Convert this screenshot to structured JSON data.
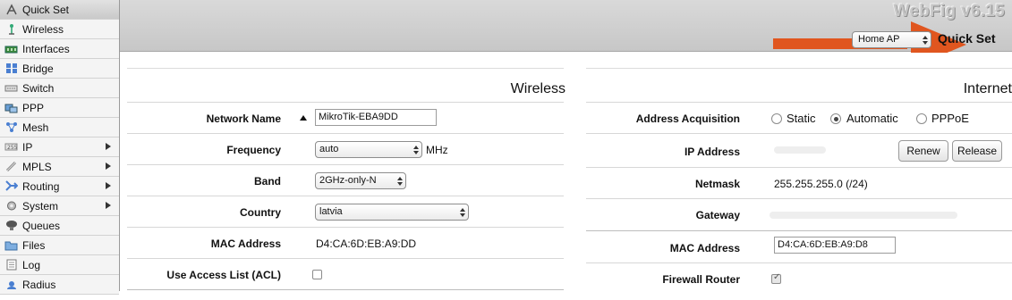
{
  "sidebar": {
    "items": [
      {
        "label": "Quick Set",
        "icon": "quickset-icon",
        "active": true,
        "arrow": false
      },
      {
        "label": "Wireless",
        "icon": "wireless-icon",
        "active": false,
        "arrow": false
      },
      {
        "label": "Interfaces",
        "icon": "interfaces-icon",
        "active": false,
        "arrow": false
      },
      {
        "label": "Bridge",
        "icon": "bridge-icon",
        "active": false,
        "arrow": false
      },
      {
        "label": "Switch",
        "icon": "switch-icon",
        "active": false,
        "arrow": false
      },
      {
        "label": "PPP",
        "icon": "ppp-icon",
        "active": false,
        "arrow": false
      },
      {
        "label": "Mesh",
        "icon": "mesh-icon",
        "active": false,
        "arrow": false
      },
      {
        "label": "IP",
        "icon": "ip-icon",
        "active": false,
        "arrow": true
      },
      {
        "label": "MPLS",
        "icon": "mpls-icon",
        "active": false,
        "arrow": true
      },
      {
        "label": "Routing",
        "icon": "routing-icon",
        "active": false,
        "arrow": true
      },
      {
        "label": "System",
        "icon": "system-icon",
        "active": false,
        "arrow": true
      },
      {
        "label": "Queues",
        "icon": "queues-icon",
        "active": false,
        "arrow": false
      },
      {
        "label": "Files",
        "icon": "files-icon",
        "active": false,
        "arrow": false
      },
      {
        "label": "Log",
        "icon": "log-icon",
        "active": false,
        "arrow": false
      },
      {
        "label": "Radius",
        "icon": "radius-icon",
        "active": false,
        "arrow": false
      }
    ]
  },
  "header": {
    "brand": "WebFig v6.15",
    "mode_select": "Home AP",
    "page_title": "Quick Set",
    "annotation_color": "#e0561f"
  },
  "wireless": {
    "title": "Wireless",
    "network_name_label": "Network Name",
    "network_name_value": "MikroTik-EBA9DD",
    "frequency_label": "Frequency",
    "frequency_value": "auto",
    "frequency_unit": "MHz",
    "band_label": "Band",
    "band_value": "2GHz-only-N",
    "country_label": "Country",
    "country_value": "latvia",
    "mac_label": "MAC Address",
    "mac_value": "D4:CA:6D:EB:A9:DD",
    "acl_label": "Use Access List (ACL)",
    "acl_checked": false
  },
  "internet": {
    "title": "Internet",
    "acquisition_label": "Address Acquisition",
    "acquisition_options": [
      "Static",
      "Automatic",
      "PPPoE"
    ],
    "acquisition_selected": "Automatic",
    "ip_label": "IP Address",
    "renew_label": "Renew",
    "release_label": "Release",
    "netmask_label": "Netmask",
    "netmask_value": "255.255.255.0 (/24)",
    "gateway_label": "Gateway",
    "mac_label": "MAC Address",
    "mac_value": "D4:CA:6D:EB:A9:D8",
    "firewall_label": "Firewall Router",
    "firewall_checked": true
  }
}
